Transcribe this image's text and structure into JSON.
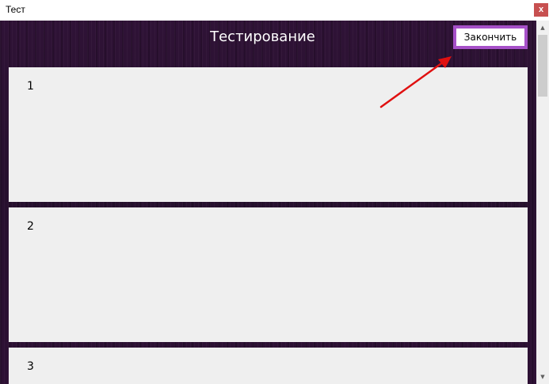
{
  "window": {
    "title": "Тест",
    "close_label": "x"
  },
  "header": {
    "title": "Тестирование",
    "finish_label": "Закончить"
  },
  "questions": [
    {
      "number": "1"
    },
    {
      "number": "2"
    },
    {
      "number": "3"
    }
  ],
  "scrollbar": {
    "up_glyph": "▲",
    "down_glyph": "▼"
  },
  "colors": {
    "background": "#2b0f33",
    "card": "#efefef",
    "button_border": "#a650c8",
    "arrow": "#e01010",
    "close_button": "#c75050"
  },
  "icons": {
    "close": "close-icon",
    "annotation": "annotation-arrow-icon"
  }
}
